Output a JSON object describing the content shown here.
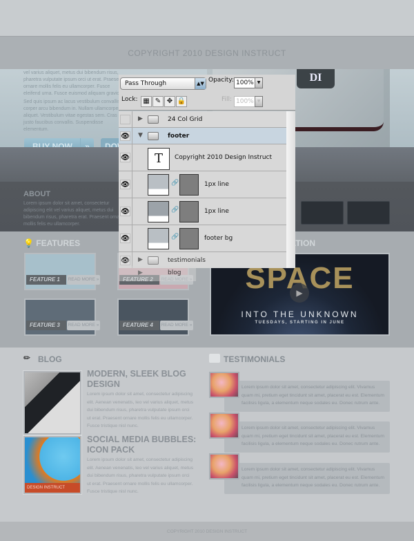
{
  "header": {
    "band_text": "COPYRIGHT 2010 DESIGN INSTRUCT"
  },
  "hero": {
    "p1": "vel varius aliquet, metus dui bibendum risus, pharetra vulputate ipsum orci ut erat. Praesent ornare mollis felis eu ullamcorper. Fusce eleifend urna. Fusce euismod aliquam gravida.",
    "p2": "Sed quis ipsum ac lacus vestibulum convallis corper arcu bibendum in. Nullam ullamcorper aliquet. Vestibulum vitae egestas sem. Cras id justo faucibus convallis. Suspendisse elementum.",
    "buy_label": "BUY NOW",
    "buy_arrow": "»",
    "second_label": "DOWNLOAD",
    "logo": "DI"
  },
  "about": {
    "title": "ABOUT",
    "text": "Lorem ipsum dolor sit amet, consectetur adipiscing elit vel varius aliquet, metus dui bibendum risus, pharetra erat. Praesent ornare mollis felis eu ullamcorper."
  },
  "features": {
    "title": "FEATURES",
    "right_title": "PRESENTATION",
    "items": [
      {
        "label": "FEATURE 1",
        "more": "READ MORE »"
      },
      {
        "label": "FEATURE 2",
        "more": "READ MORE »"
      },
      {
        "label": "FEATURE 3",
        "more": "READ MORE »"
      },
      {
        "label": "FEATURE 4",
        "more": "READ MORE »"
      }
    ],
    "video": {
      "title": "SPACE",
      "subtitle": "INTO THE UNKNOWN",
      "tagline": "TUESDAYS, STARTING IN JUNE",
      "play_icon": "play-icon"
    }
  },
  "blog": {
    "title": "BLOG",
    "posts": [
      {
        "title": "MODERN, SLEEK BLOG DESIGN",
        "text": "Lorem ipsum dolor sit amet, consectetur adipiscing elit. Aenean venenatis, leo vel varius aliquet, metus dui bibendum risus, pharetra vulputate ipsum orci ut erat. Praesent ornare mollis felis eu ullamcorper. Fusce tristique nisl nunc."
      },
      {
        "title": "SOCIAL MEDIA BUBBLES: ICON PACK",
        "text": "Lorem ipsum dolor sit amet, consectetur adipiscing elit. Aenean venenatis, leo vel varius aliquet, metus dui bibendum risus, pharetra vulputate ipsum orci ut erat. Praesent ornare mollis felis eu ullamcorper. Fusce tristique nisl nunc.",
        "badge": "DESIGN INSTRUCT"
      }
    ]
  },
  "testimonials": {
    "title": "TESTIMONIALS",
    "items": [
      "Lorem ipsum dolor sit amet, consectetur adipiscing elit. Vivamus quam mi, pretium eget tincidunt sit amet, placerat eu est. Elementum facilisis ligula, a elementum neque sodales eu. Donec rutrum ante.",
      "Lorem ipsum dolor sit amet, consectetur adipiscing elit. Vivamus quam mi, pretium eget tincidunt sit amet, placerat eu est. Elementum facilisis ligula, a elementum neque sodales eu. Donec rutrum ante.",
      "Lorem ipsum dolor sit amet, consectetur adipiscing elit. Vivamus quam mi, pretium eget tincidunt sit amet, placerat eu est. Elementum facilisis ligula, a elementum neque sodales eu. Donec rutrum ante."
    ]
  },
  "footer": {
    "text": "COPYRIGHT 2010 DESIGN INSTRUCT"
  },
  "layers_panel": {
    "blend_mode": "Pass Through",
    "opacity_label": "Opacity:",
    "opacity": "100%",
    "lock_label": "Lock:",
    "fill_label": "Fill:",
    "fill": "100%",
    "layers": [
      {
        "name": "24 Col Grid",
        "type": "group",
        "visible": false,
        "expanded": false
      },
      {
        "name": "footer",
        "type": "group",
        "visible": true,
        "expanded": true,
        "selected": true
      },
      {
        "name": "Copyright 2010 Design Instruct",
        "type": "text",
        "visible": true,
        "thumb": "T"
      },
      {
        "name": "1px line",
        "type": "shape",
        "visible": true
      },
      {
        "name": "1px line",
        "type": "shape",
        "visible": true
      },
      {
        "name": "footer bg",
        "type": "shape",
        "visible": true
      },
      {
        "name": "testimonials",
        "type": "group",
        "visible": true,
        "expanded": false
      },
      {
        "name": "blog",
        "type": "group",
        "visible": false,
        "expanded": false
      }
    ]
  }
}
